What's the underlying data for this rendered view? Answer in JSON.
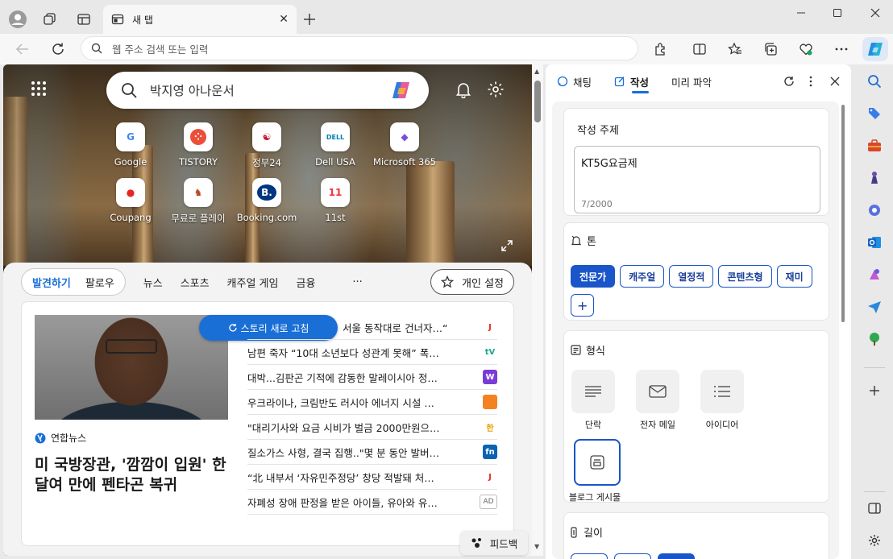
{
  "tab": {
    "title": "새 탭"
  },
  "address": {
    "placeholder": "웹 주소 검색 또는 입력"
  },
  "search": {
    "placeholder": "박지영 아나운서"
  },
  "quicklinks": [
    {
      "label": "Google",
      "glyph": "G",
      "color": "#4285f4"
    },
    {
      "label": "TISTORY",
      "glyph": "⁘",
      "color": "#ffffff",
      "bg": "#eb4f3a"
    },
    {
      "label": "정부24",
      "glyph": "☯",
      "color": "#c8102e"
    },
    {
      "label": "Dell USA",
      "glyph": "DELL",
      "color": "#007db8"
    },
    {
      "label": "Microsoft 365",
      "glyph": "◆",
      "color": "#7b4ddb"
    },
    {
      "label": "Coupang",
      "glyph": "●",
      "color": "#e52528"
    },
    {
      "label": "무료로 플레이",
      "glyph": "♞",
      "color": "#b8471f"
    },
    {
      "label": "Booking.com",
      "glyph": "B.",
      "color": "#ffffff",
      "bg": "#003580"
    },
    {
      "label": "11st",
      "glyph": "11",
      "color": "#f43142"
    }
  ],
  "feed_nav": {
    "discover": "발견하기",
    "follow": "팔로우",
    "tabs": [
      "뉴스",
      "스포츠",
      "캐주얼 게임",
      "금융"
    ],
    "more": "···",
    "personalize": "개인 설정"
  },
  "story": {
    "refresh": "스토리 새로 고침",
    "source": "연합뉴스",
    "headline": "미 국방장관, '깜깜이 입원' 한달여 만에 펜타곤 복귀"
  },
  "news": [
    {
      "text": "서울 동작대로 건너자…“",
      "logo": "J",
      "logo_color": "#e0301e"
    },
    {
      "text": "남편 죽자 “10대 소년보다 성관계 못해” 폭…",
      "logo": "tV",
      "logo_color": "#19a88c"
    },
    {
      "text": "대박...김판곤 기적에 감동한 말레이시아 정…",
      "logo": "W",
      "logo_color": "#ffffff",
      "logo_bg": "#7a3cd6"
    },
    {
      "text": "우크라이나, 크림반도 러시아 에너지 시설 …",
      "logo": "",
      "logo_color": "#ffffff",
      "logo_bg": "#f58220"
    },
    {
      "text": "\"대리기사와 요금 시비가 벌금 2000만원으…",
      "logo": "한",
      "logo_color": "#e8a000"
    },
    {
      "text": "질소가스 사형, 결국 집행..\"몇 분 동안 발버…",
      "logo": "fn",
      "logo_color": "#ffffff",
      "logo_bg": "#0a62b3"
    },
    {
      "text": "“北 내부서 ‘자유민주정당’ 창당 적발돼 처…",
      "logo": "J",
      "logo_color": "#e0301e"
    },
    {
      "text": "자폐성 장애 판정을 받은 아이들, 유아와 유…",
      "logo": "AD",
      "logo_color": "#666666"
    }
  ],
  "feedback": "피드백",
  "pane": {
    "tabs": [
      "채팅",
      "작성",
      "미리 파악"
    ],
    "topic_label": "작성 주제",
    "topic_value": "KT5G요금제",
    "topic_count": "7/2000",
    "tone_label": "톤",
    "tones": [
      "전문가",
      "캐주얼",
      "열정적",
      "콘텐츠형",
      "재미"
    ],
    "add": "+",
    "format_label": "형식",
    "formats": [
      "단락",
      "전자 메일",
      "아이디어",
      "블로그 게시물"
    ],
    "length_label": "길이"
  },
  "colors": {
    "accent": "#1a6fd6",
    "chip": "#1a55c9"
  }
}
